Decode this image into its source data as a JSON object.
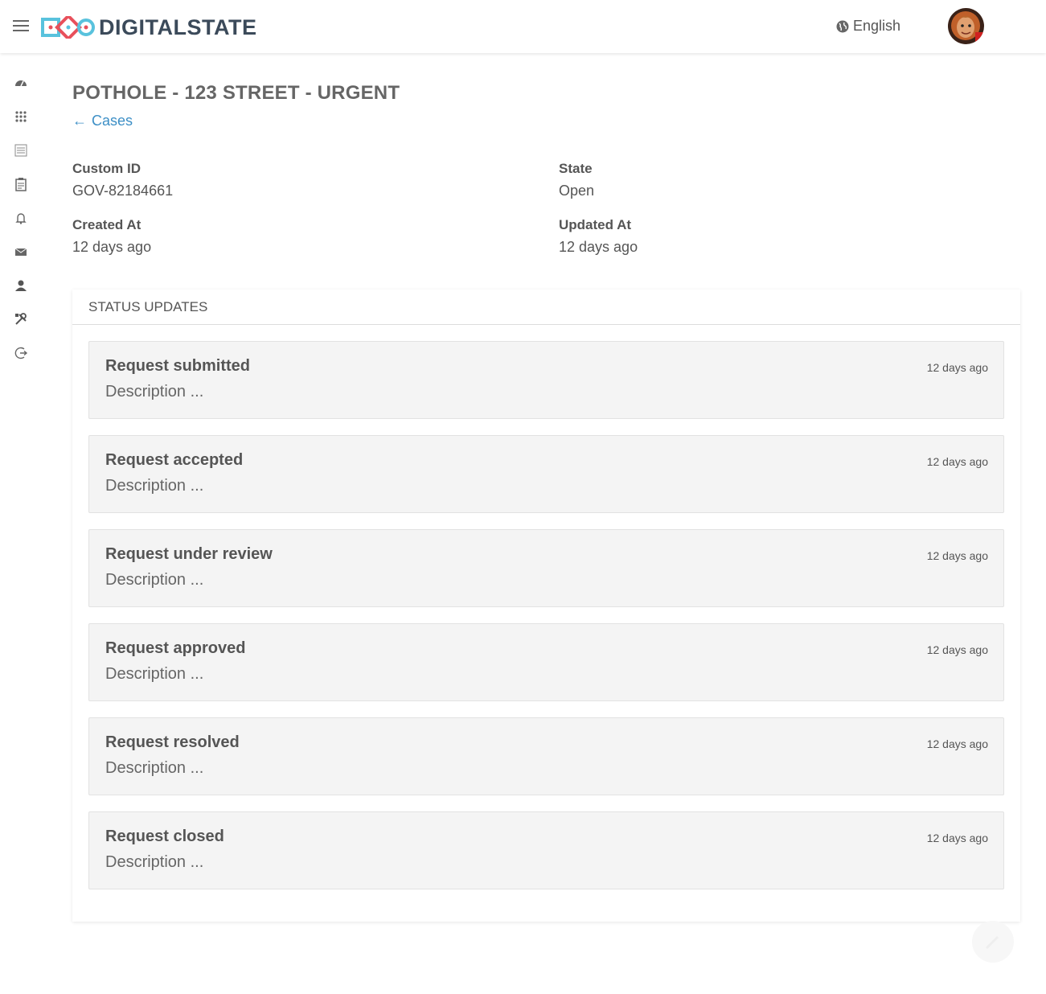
{
  "header": {
    "brand": "DIGITALSTATE",
    "language": "English"
  },
  "sidebar": {
    "items": [
      {
        "icon": "dashboard-icon"
      },
      {
        "icon": "apps-grid-icon"
      },
      {
        "icon": "list-icon"
      },
      {
        "icon": "clipboard-icon"
      },
      {
        "icon": "bell-icon"
      },
      {
        "icon": "envelope-icon"
      },
      {
        "icon": "user-icon"
      },
      {
        "icon": "tools-icon"
      },
      {
        "icon": "logout-icon"
      }
    ]
  },
  "page": {
    "title": "POTHOLE - 123 STREET - URGENT",
    "back_label": "Cases"
  },
  "details": {
    "custom_id_label": "Custom ID",
    "custom_id_value": "GOV-82184661",
    "state_label": "State",
    "state_value": "Open",
    "created_label": "Created At",
    "created_value": "12 days ago",
    "updated_label": "Updated At",
    "updated_value": "12 days ago"
  },
  "status_updates": {
    "header": "STATUS UPDATES",
    "items": [
      {
        "title": "Request submitted",
        "description": "Description ...",
        "time": "12 days ago"
      },
      {
        "title": "Request accepted",
        "description": "Description ...",
        "time": "12 days ago"
      },
      {
        "title": "Request under review",
        "description": "Description ...",
        "time": "12 days ago"
      },
      {
        "title": "Request approved",
        "description": "Description ...",
        "time": "12 days ago"
      },
      {
        "title": "Request resolved",
        "description": "Description ...",
        "time": "12 days ago"
      },
      {
        "title": "Request closed",
        "description": "Description ...",
        "time": "12 days ago"
      }
    ]
  },
  "colors": {
    "link": "#3d8fc6",
    "logo_blue": "#59c2dd",
    "logo_red": "#e8505b",
    "logo_text": "#3b4a5a"
  }
}
